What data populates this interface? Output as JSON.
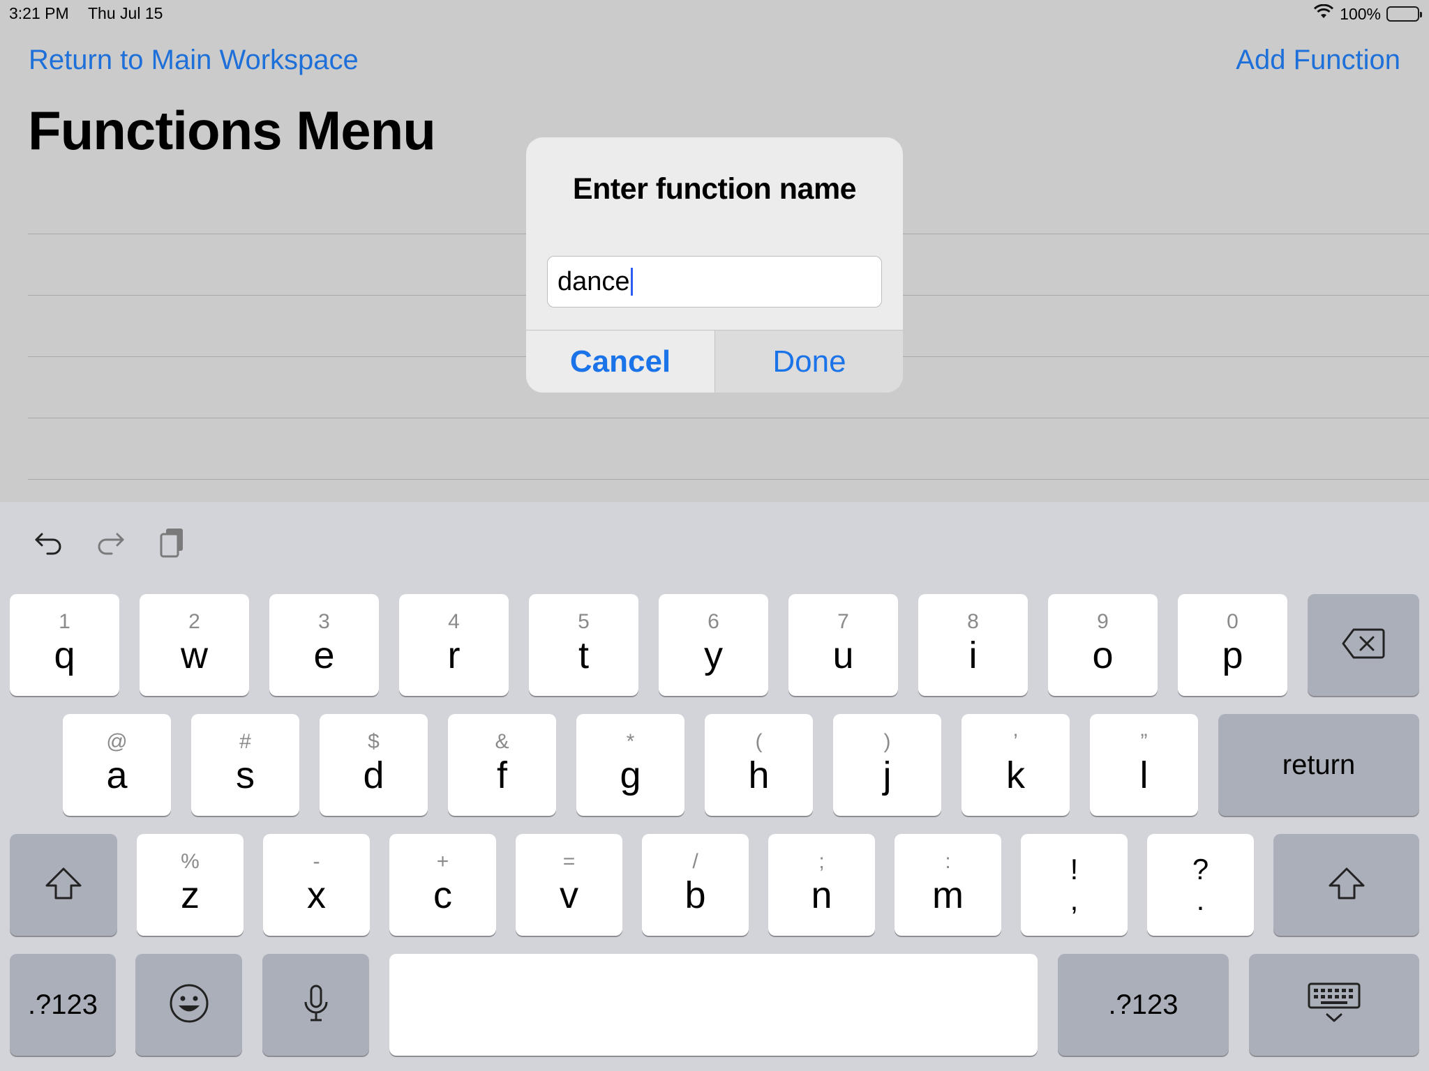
{
  "status": {
    "time": "3:21 PM",
    "date": "Thu Jul 15",
    "battery": "100%"
  },
  "nav": {
    "back_label": "Return to Main Workspace",
    "add_label": "Add Function"
  },
  "page": {
    "title": "Functions Menu"
  },
  "dialog": {
    "title": "Enter function name",
    "input_value": "dance",
    "cancel_label": "Cancel",
    "done_label": "Done"
  },
  "keyboard": {
    "row1": [
      {
        "sub": "1",
        "main": "q"
      },
      {
        "sub": "2",
        "main": "w"
      },
      {
        "sub": "3",
        "main": "e"
      },
      {
        "sub": "4",
        "main": "r"
      },
      {
        "sub": "5",
        "main": "t"
      },
      {
        "sub": "6",
        "main": "y"
      },
      {
        "sub": "7",
        "main": "u"
      },
      {
        "sub": "8",
        "main": "i"
      },
      {
        "sub": "9",
        "main": "o"
      },
      {
        "sub": "0",
        "main": "p"
      }
    ],
    "row2": [
      {
        "sub": "@",
        "main": "a"
      },
      {
        "sub": "#",
        "main": "s"
      },
      {
        "sub": "$",
        "main": "d"
      },
      {
        "sub": "&",
        "main": "f"
      },
      {
        "sub": "*",
        "main": "g"
      },
      {
        "sub": "(",
        "main": "h"
      },
      {
        "sub": ")",
        "main": "j"
      },
      {
        "sub": "’",
        "main": "k"
      },
      {
        "sub": "”",
        "main": "l"
      }
    ],
    "row3": [
      {
        "sub": "%",
        "main": "z"
      },
      {
        "sub": "-",
        "main": "x"
      },
      {
        "sub": "+",
        "main": "c"
      },
      {
        "sub": "=",
        "main": "v"
      },
      {
        "sub": "/",
        "main": "b"
      },
      {
        "sub": ";",
        "main": "n"
      },
      {
        "sub": ":",
        "main": "m"
      }
    ],
    "punct1": {
      "top": "!",
      "bottom": ","
    },
    "punct2": {
      "top": "?",
      "bottom": "."
    },
    "return_label": "return",
    "numbers_label": ".?123"
  }
}
